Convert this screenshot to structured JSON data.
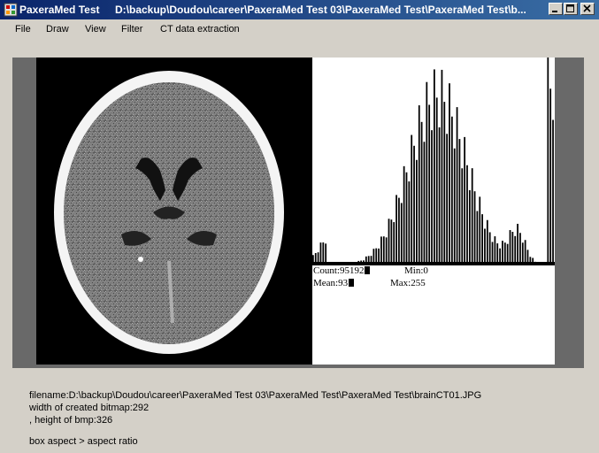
{
  "window": {
    "app_name": "PaxeraMed Test",
    "title_path": "D:\\backup\\Doudou\\career\\PaxeraMed Test 03\\PaxeraMed Test\\PaxeraMed Test\\b...",
    "icon": "app-icon"
  },
  "menu": [
    "File",
    "Draw",
    "View",
    "Filter",
    "CT data extraction"
  ],
  "histogram_stats": {
    "count": "Count:95192",
    "min": "Min:0",
    "mean": "Mean:93",
    "max": "Max:255"
  },
  "info": {
    "filename": "filename:D:\\backup\\Doudou\\career\\PaxeraMed Test 03\\PaxeraMed Test\\PaxeraMed Test\\brainCT01.JPG",
    "width": "width of created bitmap:292",
    "height": ", height of bmp:326",
    "aspect": " box aspect > aspect ratio"
  },
  "colors": {
    "titlebar": "#0a246a",
    "viewer_bg": "#696969",
    "window_bg": "#d4d0c8"
  }
}
